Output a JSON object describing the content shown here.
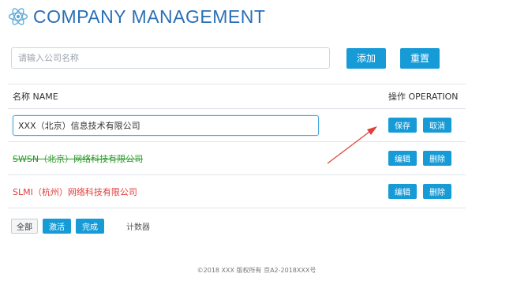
{
  "header": {
    "title": "COMPANY MANAGEMENT",
    "logo_icon": "react-atom-icon",
    "accent": "#2a6fb5"
  },
  "search": {
    "placeholder": "请输入公司名称",
    "value": "",
    "add_label": "添加",
    "reset_label": "重置"
  },
  "table": {
    "col_name": "名称 NAME",
    "col_op": "操作 OPERATION",
    "editing_row": {
      "value": "XXX（北京）信息技术有限公司",
      "save_label": "保存",
      "cancel_label": "取消"
    },
    "rows": [
      {
        "name": "SWSN（北京）网络科技有限公司",
        "status": "done",
        "color": "#2a9a2a",
        "edit_label": "编辑",
        "delete_label": "删除"
      },
      {
        "name": "SLMI（杭州）网络科技有限公司",
        "status": "active",
        "color": "#e23a3a",
        "edit_label": "编辑",
        "delete_label": "删除"
      }
    ]
  },
  "filters": {
    "all": "全部",
    "active": "激活",
    "done": "完成",
    "counter": "计数器"
  },
  "footer": {
    "text": "©2018 XXX 版权所有 京A2-2018XXX号"
  },
  "colors": {
    "primary_button": "#179bd7",
    "annotation_arrow": "#e0403a"
  }
}
